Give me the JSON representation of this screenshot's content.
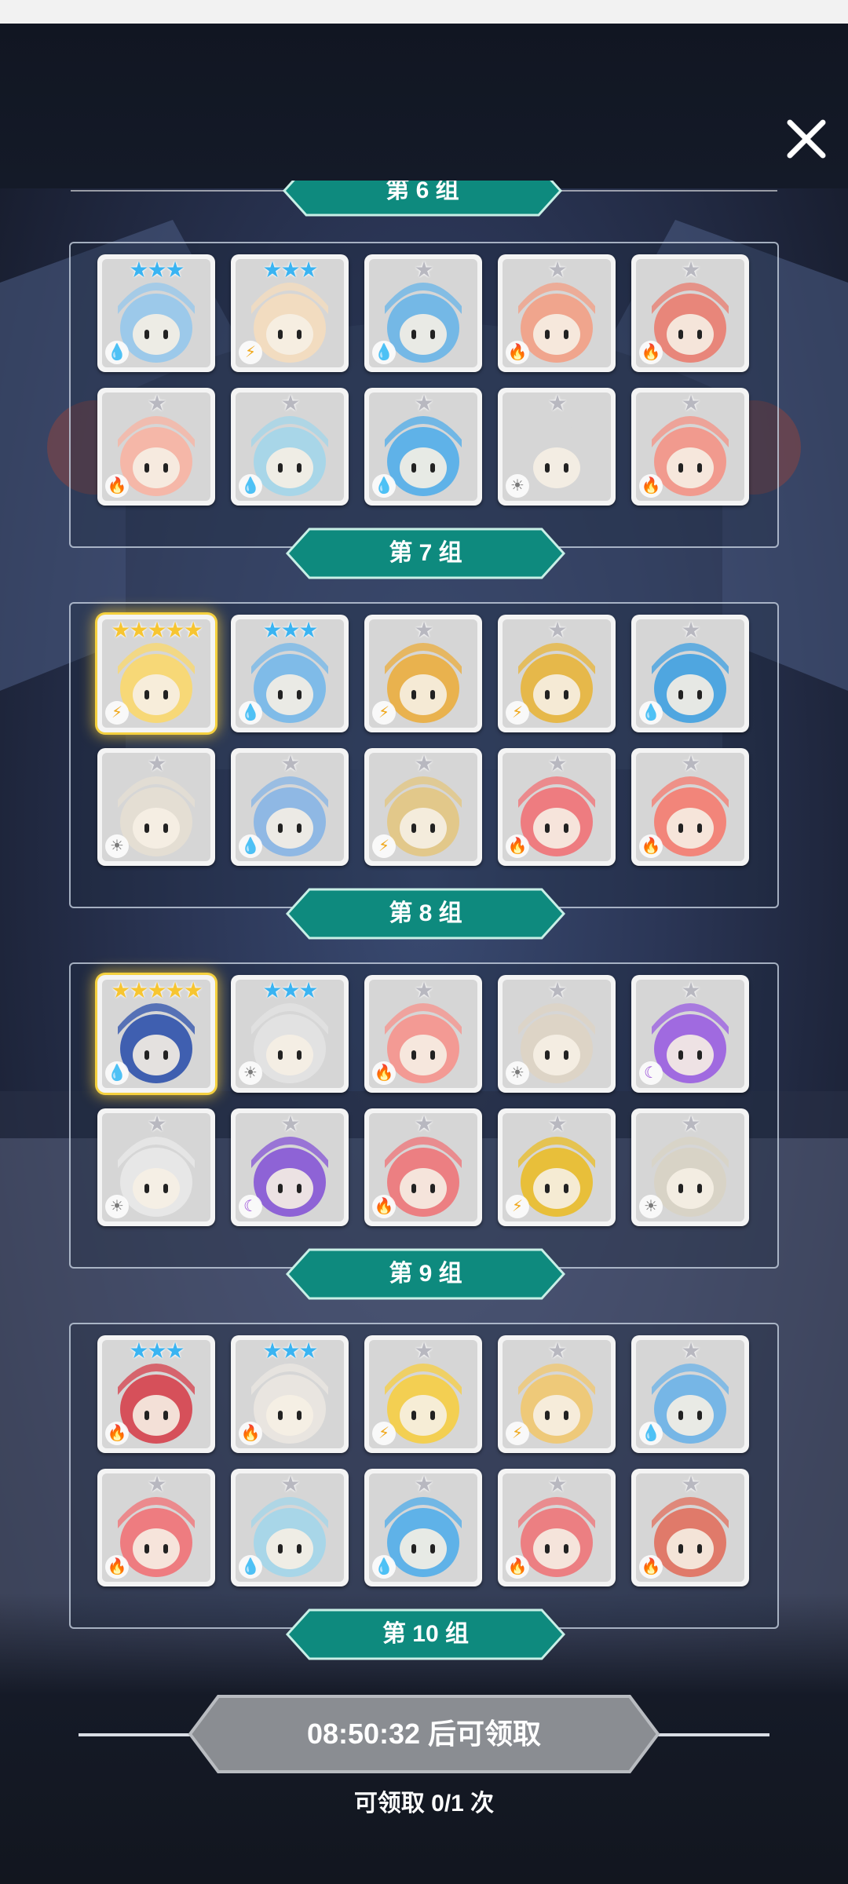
{
  "close_icon": "close-icon",
  "groups": [
    {
      "label": "第 7 组",
      "cards": [
        {
          "stars": "★★★",
          "star_color": "blue",
          "element": "water",
          "hue": "#9cc9ea"
        },
        {
          "stars": "★★★",
          "star_color": "blue",
          "element": "lightning",
          "hue": "#f2dcc0"
        },
        {
          "stars": "★",
          "star_color": "grey",
          "element": "water",
          "hue": "#74b8e6"
        },
        {
          "stars": "★",
          "star_color": "grey",
          "element": "fire",
          "hue": "#f0a58d"
        },
        {
          "stars": "★",
          "star_color": "grey",
          "element": "fire",
          "hue": "#e8867a"
        },
        {
          "stars": "★",
          "star_color": "grey",
          "element": "fire",
          "hue": "#f5b7a8"
        },
        {
          "stars": "★",
          "star_color": "grey",
          "element": "water",
          "hue": "#a8d6e8"
        },
        {
          "stars": "★",
          "star_color": "grey",
          "element": "water",
          "hue": "#5fb2e8"
        },
        {
          "stars": "★",
          "star_color": "grey",
          "element": "light",
          "hue": "#d6d6d6"
        },
        {
          "stars": "★",
          "star_color": "grey",
          "element": "fire",
          "hue": "#f19a8e"
        }
      ]
    },
    {
      "label": "第 8 组",
      "cards": [
        {
          "stars": "★★★★★",
          "star_color": "gold",
          "element": "lightning",
          "hue": "#f7d877",
          "highlight": true
        },
        {
          "stars": "★★★",
          "star_color": "blue",
          "element": "water",
          "hue": "#7fbbe8"
        },
        {
          "stars": "★",
          "star_color": "grey",
          "element": "lightning",
          "hue": "#e9b24e"
        },
        {
          "stars": "★",
          "star_color": "grey",
          "element": "lightning",
          "hue": "#e6b84a"
        },
        {
          "stars": "★",
          "star_color": "grey",
          "element": "water",
          "hue": "#4fa6e0"
        },
        {
          "stars": "★",
          "star_color": "grey",
          "element": "light",
          "hue": "#e4ded3"
        },
        {
          "stars": "★",
          "star_color": "grey",
          "element": "water",
          "hue": "#8fb8e4"
        },
        {
          "stars": "★",
          "star_color": "grey",
          "element": "lightning",
          "hue": "#e2c88a"
        },
        {
          "stars": "★",
          "star_color": "grey",
          "element": "fire",
          "hue": "#ee7c80"
        },
        {
          "stars": "★",
          "star_color": "grey",
          "element": "fire",
          "hue": "#f2857a"
        }
      ]
    },
    {
      "label": "第 9 组",
      "cards": [
        {
          "stars": "★★★★★",
          "star_color": "gold",
          "element": "water",
          "hue": "#3f5fb0",
          "highlight": true
        },
        {
          "stars": "★★★",
          "star_color": "blue",
          "element": "light",
          "hue": "#e2e2e2"
        },
        {
          "stars": "★",
          "star_color": "grey",
          "element": "fire",
          "hue": "#f39a94"
        },
        {
          "stars": "★",
          "star_color": "grey",
          "element": "light",
          "hue": "#ddd4c6"
        },
        {
          "stars": "★",
          "star_color": "grey",
          "element": "dark",
          "hue": "#a06ae0"
        },
        {
          "stars": "★",
          "star_color": "grey",
          "element": "light",
          "hue": "#e7e7e7"
        },
        {
          "stars": "★",
          "star_color": "grey",
          "element": "dark",
          "hue": "#8e63d6"
        },
        {
          "stars": "★",
          "star_color": "grey",
          "element": "fire",
          "hue": "#ec7f82"
        },
        {
          "stars": "★",
          "star_color": "grey",
          "element": "lightning",
          "hue": "#e8bf3a"
        },
        {
          "stars": "★",
          "star_color": "grey",
          "element": "light",
          "hue": "#d8d3c6"
        }
      ]
    },
    {
      "label": "第 10 组",
      "cards": [
        {
          "stars": "★★★",
          "star_color": "blue",
          "element": "fire",
          "hue": "#d6505a"
        },
        {
          "stars": "★★★",
          "star_color": "blue",
          "element": "fire",
          "hue": "#e9e5e0"
        },
        {
          "stars": "★",
          "star_color": "grey",
          "element": "lightning",
          "hue": "#f3cf52"
        },
        {
          "stars": "★",
          "star_color": "grey",
          "element": "lightning",
          "hue": "#eec979"
        },
        {
          "stars": "★",
          "star_color": "grey",
          "element": "water",
          "hue": "#76b6e6"
        },
        {
          "stars": "★",
          "star_color": "grey",
          "element": "fire",
          "hue": "#ee7c80"
        },
        {
          "stars": "★",
          "star_color": "grey",
          "element": "water",
          "hue": "#a8d6e8"
        },
        {
          "stars": "★",
          "star_color": "grey",
          "element": "water",
          "hue": "#5fb2e8"
        },
        {
          "stars": "★",
          "star_color": "grey",
          "element": "fire",
          "hue": "#ec7f82"
        },
        {
          "stars": "★",
          "star_color": "grey",
          "element": "fire",
          "hue": "#e07a6a"
        }
      ]
    }
  ],
  "partial_group_label": "第 6 组",
  "claim": {
    "button_label": "08:50:32 后可领取",
    "count_label": "可领取 0/1 次"
  },
  "colors": {
    "tab_teal": "#0e8a7e",
    "button_grey": "#8a8d92",
    "water": "#2f8fe0",
    "fire": "#e2452f",
    "lightning": "#f0a81c",
    "light": "#7a7a7a",
    "dark": "#9a4fd8"
  }
}
